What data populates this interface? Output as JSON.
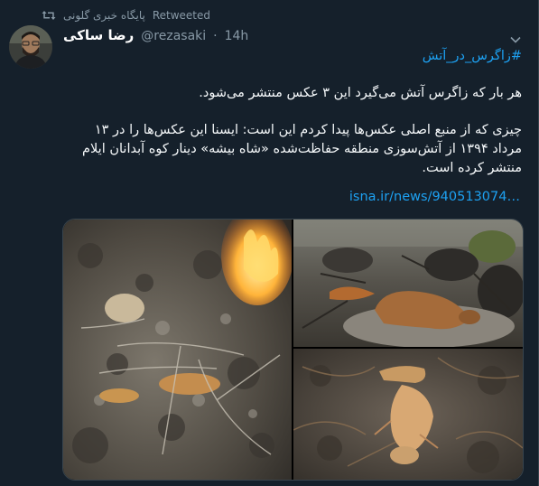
{
  "retweet": {
    "icon": "retweet-icon",
    "by": "پایگاه خبری گلونی",
    "label": "Retweeted"
  },
  "author": {
    "display_name": "رضا ساکی",
    "handle": "@rezasaki",
    "separator": "·",
    "time": "14h",
    "avatar": "avatar-photo"
  },
  "tweet": {
    "hashtag": "#زاگرس_در_آتش",
    "paragraph_1": "هر بار که زاگرس آتش می‌گیرد این ۳ عکس منتشر می‌شود.",
    "paragraph_2": "چیزی که از منبع اصلی عکس‌ها پیدا کردم این است: ایسنا این عکس‌ها را در ۱۳ مرداد ۱۳۹۴ از آتش‌سوزی منطقه حفاظت‌شده «شاه بیشه» دینار کوه آبدانان ایلام منتشر کرده است.",
    "link": "isna.ir/news/940513074…"
  },
  "media": {
    "photos": [
      {
        "name": "burned-ground-with-flames-photo"
      },
      {
        "name": "burned-squirrel-on-rock-photo"
      },
      {
        "name": "dead-squirrel-on-ash-photo"
      }
    ]
  },
  "colors": {
    "background": "#15202b",
    "link": "#1da1f2",
    "muted": "#8899a6",
    "border": "#38444d"
  }
}
